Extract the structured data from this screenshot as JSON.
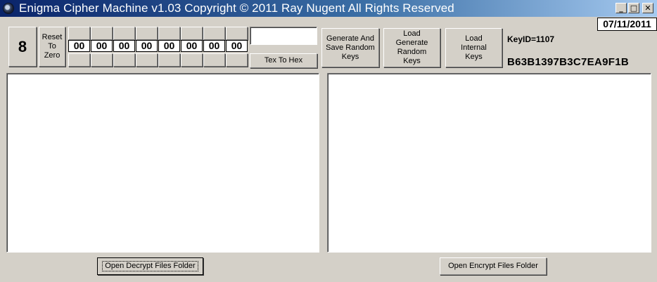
{
  "window": {
    "title": "Enigma Cipher Machine  v1.03 Copyright © 2011 Ray Nugent All Rights Reserved",
    "minimize": "_",
    "maximize": "□",
    "close": "✕"
  },
  "date": "07/11/2011",
  "counter": {
    "value": "8"
  },
  "reset_button": "Reset To Zero",
  "digits": [
    "00",
    "00",
    "00",
    "00",
    "00",
    "00",
    "00",
    "00"
  ],
  "hex_input": {
    "value": "",
    "placeholder": ""
  },
  "tex_to_hex_button": "Tex To Hex",
  "generate_button": "Generate  And Save Random Keys",
  "load_generated_button": "Load Generate Random Keys",
  "load_internal_button": "Load Internal Keys",
  "key": {
    "id_label": "KeyID=1107",
    "hex": "B63B1397B3C7EA9F1B"
  },
  "left_pane": {
    "text": ""
  },
  "right_pane": {
    "text": ""
  },
  "open_decrypt_button": "Open Decrypt Files Folder",
  "open_encrypt_button": "Open Encrypt Files Folder",
  "colors": {
    "titlebar_start": "#0a246a",
    "titlebar_end": "#a6caf0",
    "face": "#d4d0c8"
  }
}
